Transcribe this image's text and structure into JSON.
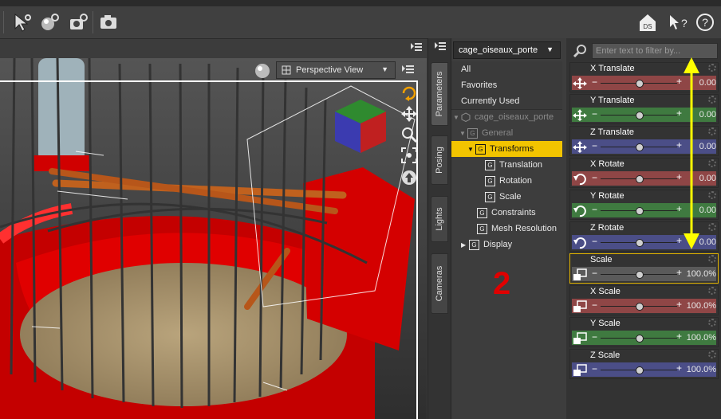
{
  "colors": {
    "x_axis": "#8f4646",
    "y_axis": "#3f7a40",
    "z_axis": "#4b4e87",
    "neutral": "#5a5a5a",
    "selection": "#f2c400",
    "annotation_arrow": "#ffff00",
    "annotation_number": "#e00000"
  },
  "toolbar": {
    "icons": [
      "cursor-select-icon",
      "sphere-light-icon",
      "gear-render-icon",
      "render-settings-icon",
      "camera-icon"
    ],
    "right_icons": [
      "home-ds-icon",
      "help-pointer-icon",
      "help-icon"
    ],
    "ds_label": "DS"
  },
  "viewport": {
    "camera_label": "Perspective View",
    "tools": [
      "orbit-icon",
      "pan-icon",
      "zoom-icon",
      "frame-icon",
      "reset-icon"
    ]
  },
  "side_tabs": [
    {
      "label": "Parameters"
    },
    {
      "label": "Posing"
    },
    {
      "label": "Lights"
    },
    {
      "label": "Cameras"
    }
  ],
  "tree": {
    "node_selected": "cage_oiseaux_porte",
    "filters": [
      "All",
      "Favorites",
      "Currently Used"
    ],
    "items": [
      {
        "label": "cage_oiseaux_porte"
      },
      {
        "label": "General"
      },
      {
        "label": "Transforms"
      },
      {
        "label": "Translation"
      },
      {
        "label": "Rotation"
      },
      {
        "label": "Scale"
      },
      {
        "label": "Constraints"
      },
      {
        "label": "Mesh Resolution"
      },
      {
        "label": "Display"
      }
    ]
  },
  "annotation_number": "2",
  "params": {
    "filter_placeholder": "Enter text to filter by...",
    "rows": [
      {
        "name": "X Translate",
        "value": "0.00",
        "axis": "x",
        "slider": 0.5
      },
      {
        "name": "Y Translate",
        "value": "0.00",
        "axis": "y",
        "slider": 0.5
      },
      {
        "name": "Z Translate",
        "value": "0.00",
        "axis": "z",
        "slider": 0.5
      },
      {
        "name": "X Rotate",
        "value": "0.00",
        "axis": "x",
        "slider": 0.5
      },
      {
        "name": "Y Rotate",
        "value": "0.00",
        "axis": "y",
        "slider": 0.5
      },
      {
        "name": "Z Rotate",
        "value": "0.00",
        "axis": "z",
        "slider": 0.5
      },
      {
        "name": "Scale",
        "value": "100.0%",
        "axis": "n",
        "slider": 0.5
      },
      {
        "name": "X Scale",
        "value": "100.0%",
        "axis": "x",
        "slider": 0.5
      },
      {
        "name": "Y Scale",
        "value": "100.0%",
        "axis": "y",
        "slider": 0.5
      },
      {
        "name": "Z Scale",
        "value": "100.0%",
        "axis": "z",
        "slider": 0.5
      }
    ]
  }
}
